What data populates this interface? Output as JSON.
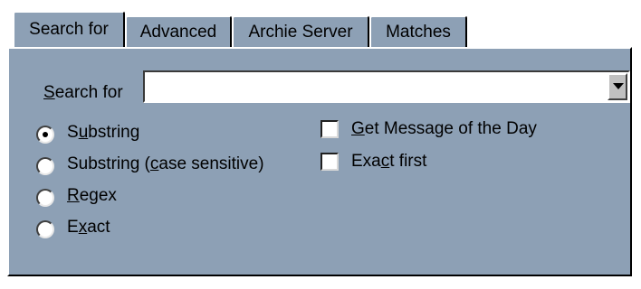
{
  "tabs": [
    {
      "label": "Search for",
      "active": true
    },
    {
      "label": "Advanced",
      "active": false
    },
    {
      "label": "Archie Server",
      "active": false
    },
    {
      "label": "Matches",
      "active": false
    }
  ],
  "search": {
    "label_prefix": "S",
    "label_rest": "earch for",
    "value": ""
  },
  "radio_options": [
    {
      "pre": "S",
      "u": "u",
      "post": "bstring",
      "selected": true
    },
    {
      "pre": "Substring (",
      "u": "c",
      "post": "ase sensitive)",
      "selected": false
    },
    {
      "pre": "",
      "u": "R",
      "post": "egex",
      "selected": false
    },
    {
      "pre": "E",
      "u": "x",
      "post": "act",
      "selected": false
    }
  ],
  "checkboxes": [
    {
      "pre": "",
      "u": "G",
      "post": "et Message of the Day",
      "checked": false
    },
    {
      "pre": "Exa",
      "u": "c",
      "post": "t first",
      "checked": false
    }
  ],
  "colors": {
    "panel": "#8da0b5",
    "highlight": "#ffffff",
    "shadow": "#000000"
  },
  "icons": {
    "dropdown": "chevron-down-icon"
  }
}
